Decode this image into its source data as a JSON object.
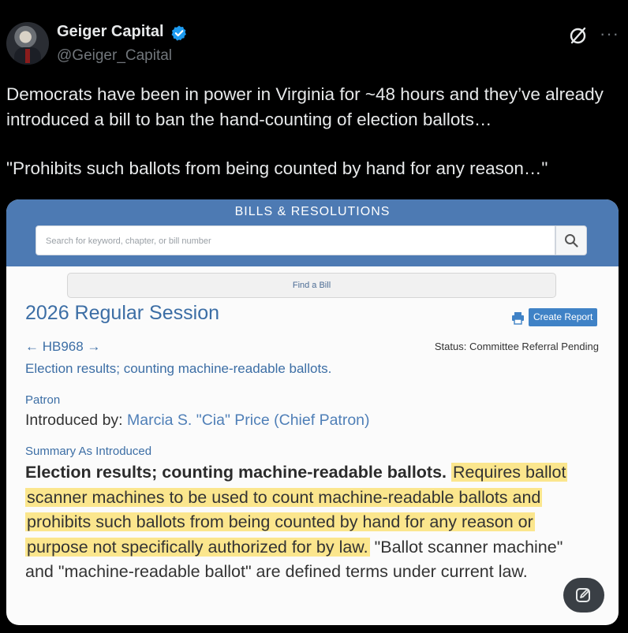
{
  "author": {
    "display_name": "Geiger Capital",
    "handle": "@Geiger_Capital"
  },
  "icons": {
    "verified": "verified-badge-icon",
    "grok": "grok-icon",
    "more": "more-icon",
    "search": "search-icon",
    "printer": "printer-icon",
    "compose": "compose-icon"
  },
  "colors": {
    "verified": "#1d9bf0",
    "header_band": "#4d7ab3",
    "link_blue": "#3c6ea5",
    "highlight": "#fbe68d"
  },
  "tweet": {
    "line1": "Democrats have been in power in Virginia for ~48 hours and they’ve already introduced a bill to ban the hand-counting of election ballots…",
    "line2": "\"Prohibits such ballots from being counted by hand for any reason…\""
  },
  "more_symbol": "···",
  "card": {
    "header_title": "BILLS & RESOLUTIONS",
    "search_placeholder": "Search for keyword, chapter, or bill number",
    "find_bill": "Find a Bill",
    "session": "2026 Regular Session",
    "create_report": "Create Report",
    "bill_nav": "← HB968 →",
    "status": "Status: Committee Referral Pending",
    "bill_title": "Election results; counting machine-readable ballots.",
    "patron_label": "Patron",
    "introduced_prefix": "Introduced by: ",
    "patron_name": "Marcia S. \"Cia\" Price (Chief Patron)",
    "summary_label": "Summary As Introduced",
    "summary_lead": "Election results; counting machine-readable ballots.",
    "summary_highlight": "Requires ballot scanner machines to be used to count machine-readable ballots and prohibits such ballots from being counted by hand for any reason or purpose not specifically authorized for by law.",
    "summary_rest": "\"Ballot scanner machine\" and \"machine-readable ballot\" are defined terms under current law."
  }
}
